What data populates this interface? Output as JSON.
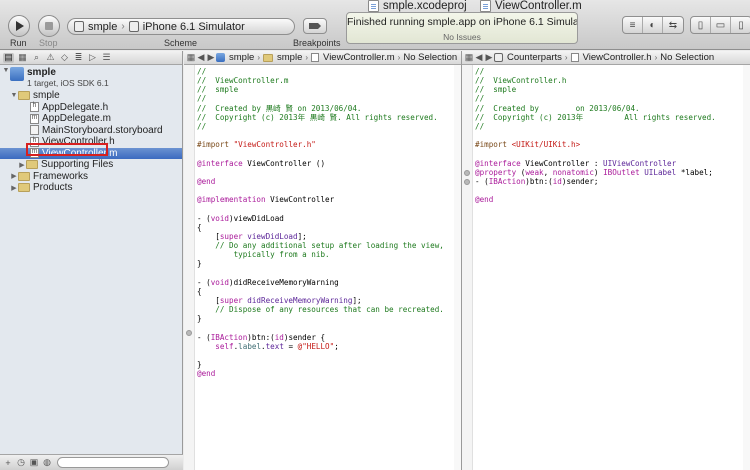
{
  "window": {
    "title_project": "smple.xcodeproj",
    "title_file": "ViewController.m"
  },
  "toolbar": {
    "run_label": "Run",
    "stop_label": "Stop",
    "scheme_label": "Scheme",
    "scheme_target": "smple",
    "scheme_destination": "iPhone 6.1 Simulator",
    "breakpoints_label": "Breakpoints",
    "activity_status": "Finished running smple.app on iPhone 6.1 Simulator",
    "activity_issues": "No Issues"
  },
  "navigator": {
    "project_name": "smple",
    "project_sub": "1 target, iOS SDK 6.1",
    "group_name": "smple",
    "files": [
      "AppDelegate.h",
      "AppDelegate.m",
      "MainStoryboard.storyboard",
      "ViewController.h",
      "ViewController.m"
    ],
    "subgroups": [
      "Supporting Files",
      "Frameworks",
      "Products"
    ],
    "selected_file": "ViewController.m"
  },
  "left_editor": {
    "jump_items": [
      "smple",
      "smple",
      "ViewController.m",
      "No Selection"
    ],
    "lines": [
      [
        {
          "t": "//",
          "c": "c-comment"
        }
      ],
      [
        {
          "t": "//  ViewController.m",
          "c": "c-comment"
        }
      ],
      [
        {
          "t": "//  smple",
          "c": "c-comment"
        }
      ],
      [
        {
          "t": "//",
          "c": "c-comment"
        }
      ],
      [
        {
          "t": "//  Created by 黒崎 賢 on 2013/06/04.",
          "c": "c-comment"
        }
      ],
      [
        {
          "t": "//  Copyright (c) 2013年 黒崎 賢. All rights reserved.",
          "c": "c-comment"
        }
      ],
      [
        {
          "t": "//",
          "c": "c-comment"
        }
      ],
      [
        {
          "t": "",
          "c": "c-plain"
        }
      ],
      [
        {
          "t": "#import ",
          "c": "c-dir"
        },
        {
          "t": "\"ViewController.h\"",
          "c": "c-str"
        }
      ],
      [
        {
          "t": "",
          "c": "c-plain"
        }
      ],
      [
        {
          "t": "@interface",
          "c": "c-kw"
        },
        {
          "t": " ViewController ()",
          "c": "c-plain"
        }
      ],
      [
        {
          "t": "",
          "c": "c-plain"
        }
      ],
      [
        {
          "t": "@end",
          "c": "c-kw"
        }
      ],
      [
        {
          "t": "",
          "c": "c-plain"
        }
      ],
      [
        {
          "t": "@implementation",
          "c": "c-kw"
        },
        {
          "t": " ViewController",
          "c": "c-plain"
        }
      ],
      [
        {
          "t": "",
          "c": "c-plain"
        }
      ],
      [
        {
          "t": "- (",
          "c": "c-plain"
        },
        {
          "t": "void",
          "c": "c-kw"
        },
        {
          "t": ")viewDidLoad",
          "c": "c-plain"
        }
      ],
      [
        {
          "t": "{",
          "c": "c-plain"
        }
      ],
      [
        {
          "t": "    [",
          "c": "c-plain"
        },
        {
          "t": "super",
          "c": "c-kw"
        },
        {
          "t": " viewDidLoad",
          "c": "c-type"
        },
        {
          "t": "];",
          "c": "c-plain"
        }
      ],
      [
        {
          "t": "    // Do any additional setup after loading the view,",
          "c": "c-comment"
        }
      ],
      [
        {
          "t": "        typically from a nib.",
          "c": "c-comment"
        }
      ],
      [
        {
          "t": "}",
          "c": "c-plain"
        }
      ],
      [
        {
          "t": "",
          "c": "c-plain"
        }
      ],
      [
        {
          "t": "- (",
          "c": "c-plain"
        },
        {
          "t": "void",
          "c": "c-kw"
        },
        {
          "t": ")didReceiveMemoryWarning",
          "c": "c-plain"
        }
      ],
      [
        {
          "t": "{",
          "c": "c-plain"
        }
      ],
      [
        {
          "t": "    [",
          "c": "c-plain"
        },
        {
          "t": "super",
          "c": "c-kw"
        },
        {
          "t": " didReceiveMemoryWarning",
          "c": "c-type"
        },
        {
          "t": "];",
          "c": "c-plain"
        }
      ],
      [
        {
          "t": "    // Dispose of any resources that can be recreated.",
          "c": "c-comment"
        }
      ],
      [
        {
          "t": "}",
          "c": "c-plain"
        }
      ],
      [
        {
          "t": "",
          "c": "c-plain"
        }
      ],
      [
        {
          "t": "- (",
          "c": "c-plain"
        },
        {
          "t": "IBAction",
          "c": "c-kw"
        },
        {
          "t": ")btn:(",
          "c": "c-plain"
        },
        {
          "t": "id",
          "c": "c-kw"
        },
        {
          "t": ")sender {",
          "c": "c-plain"
        }
      ],
      [
        {
          "t": "    ",
          "c": "c-plain"
        },
        {
          "t": "self",
          "c": "c-kw"
        },
        {
          "t": ".",
          "c": "c-plain"
        },
        {
          "t": "label",
          "c": "c-proj"
        },
        {
          "t": ".",
          "c": "c-plain"
        },
        {
          "t": "text",
          "c": "c-type"
        },
        {
          "t": " = ",
          "c": "c-plain"
        },
        {
          "t": "@\"HELLO\"",
          "c": "c-str"
        },
        {
          "t": ";",
          "c": "c-plain"
        }
      ],
      [
        {
          "t": "",
          "c": "c-plain"
        }
      ],
      [
        {
          "t": "}",
          "c": "c-plain"
        }
      ],
      [
        {
          "t": "@end",
          "c": "c-kw"
        }
      ]
    ]
  },
  "right_editor": {
    "jump_items": [
      "Counterparts",
      "ViewController.h",
      "No Selection"
    ],
    "lines": [
      [
        {
          "t": "//",
          "c": "c-comment"
        }
      ],
      [
        {
          "t": "//  ViewController.h",
          "c": "c-comment"
        }
      ],
      [
        {
          "t": "//  smple",
          "c": "c-comment"
        }
      ],
      [
        {
          "t": "//",
          "c": "c-comment"
        }
      ],
      [
        {
          "t": "//  Created by        on 2013/06/04.",
          "c": "c-comment"
        }
      ],
      [
        {
          "t": "//  Copyright (c) 2013年         All rights reserved.",
          "c": "c-comment"
        }
      ],
      [
        {
          "t": "//",
          "c": "c-comment"
        }
      ],
      [
        {
          "t": "",
          "c": "c-plain"
        }
      ],
      [
        {
          "t": "#import ",
          "c": "c-dir"
        },
        {
          "t": "<UIKit/UIKit.h>",
          "c": "c-str"
        }
      ],
      [
        {
          "t": "",
          "c": "c-plain"
        }
      ],
      [
        {
          "t": "@interface",
          "c": "c-kw"
        },
        {
          "t": " ViewController : ",
          "c": "c-plain"
        },
        {
          "t": "UIViewController",
          "c": "c-type"
        }
      ],
      [
        {
          "t": "@property",
          "c": "c-kw"
        },
        {
          "t": " (",
          "c": "c-plain"
        },
        {
          "t": "weak",
          "c": "c-kw"
        },
        {
          "t": ", ",
          "c": "c-plain"
        },
        {
          "t": "nonatomic",
          "c": "c-kw"
        },
        {
          "t": ") ",
          "c": "c-plain"
        },
        {
          "t": "IBOutlet",
          "c": "c-kw"
        },
        {
          "t": " ",
          "c": "c-plain"
        },
        {
          "t": "UILabel",
          "c": "c-type"
        },
        {
          "t": " *label;",
          "c": "c-plain"
        }
      ],
      [
        {
          "t": "- (",
          "c": "c-plain"
        },
        {
          "t": "IBAction",
          "c": "c-kw"
        },
        {
          "t": ")btn:(",
          "c": "c-plain"
        },
        {
          "t": "id",
          "c": "c-kw"
        },
        {
          "t": ")sender;",
          "c": "c-plain"
        }
      ],
      [
        {
          "t": "",
          "c": "c-plain"
        }
      ],
      [
        {
          "t": "@end",
          "c": "c-kw"
        }
      ]
    ]
  }
}
